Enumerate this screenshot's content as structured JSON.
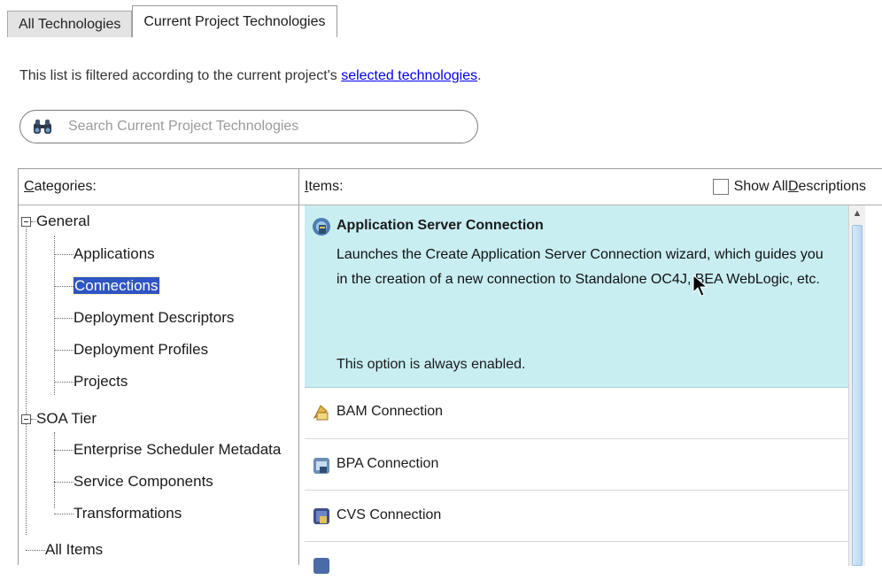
{
  "tabs": [
    {
      "label": "All Technologies",
      "active": false
    },
    {
      "label": "Current Project Technologies",
      "active": true
    }
  ],
  "filter": {
    "prefix": "This list is filtered according to the current project's ",
    "link": "selected technologies",
    "suffix": "."
  },
  "search": {
    "placeholder": "Search Current Project Technologies",
    "icon": "binoculars-icon"
  },
  "categories": {
    "header_mnemonic": "C",
    "header_rest": "ategories:",
    "tree": [
      {
        "label": "General",
        "expanded": true
      },
      {
        "label": "Applications"
      },
      {
        "label": "Connections",
        "selected": true
      },
      {
        "label": "Deployment Descriptors"
      },
      {
        "label": "Deployment Profiles"
      },
      {
        "label": "Projects"
      },
      {
        "label": "SOA Tier",
        "expanded": true
      },
      {
        "label": "Enterprise Scheduler Metadata"
      },
      {
        "label": "Service Components"
      },
      {
        "label": "Transformations"
      },
      {
        "label": "All Items"
      }
    ]
  },
  "items": {
    "header_mnemonic": "I",
    "header_rest": "tems:",
    "show_all_pre": "Show All ",
    "show_all_mnemonic": "D",
    "show_all_post": "escriptions",
    "show_all_checked": false,
    "list": [
      {
        "title": "Application Server Connection",
        "selected": true,
        "icon": "server-connection-icon",
        "description": "Launches the Create Application Server Connection wizard, which guides you in the creation of a new connection to Standalone OC4J, BEA WebLogic, etc.",
        "note": "This option is always enabled."
      },
      {
        "title": "BAM Connection",
        "icon": "bam-connection-icon"
      },
      {
        "title": "BPA Connection",
        "icon": "bpa-connection-icon"
      },
      {
        "title": "CVS Connection",
        "icon": "cvs-connection-icon"
      }
    ]
  },
  "colors": {
    "selection": "#2f55c4",
    "item_selected_bg": "#c8eef2",
    "link": "#0000ee"
  }
}
